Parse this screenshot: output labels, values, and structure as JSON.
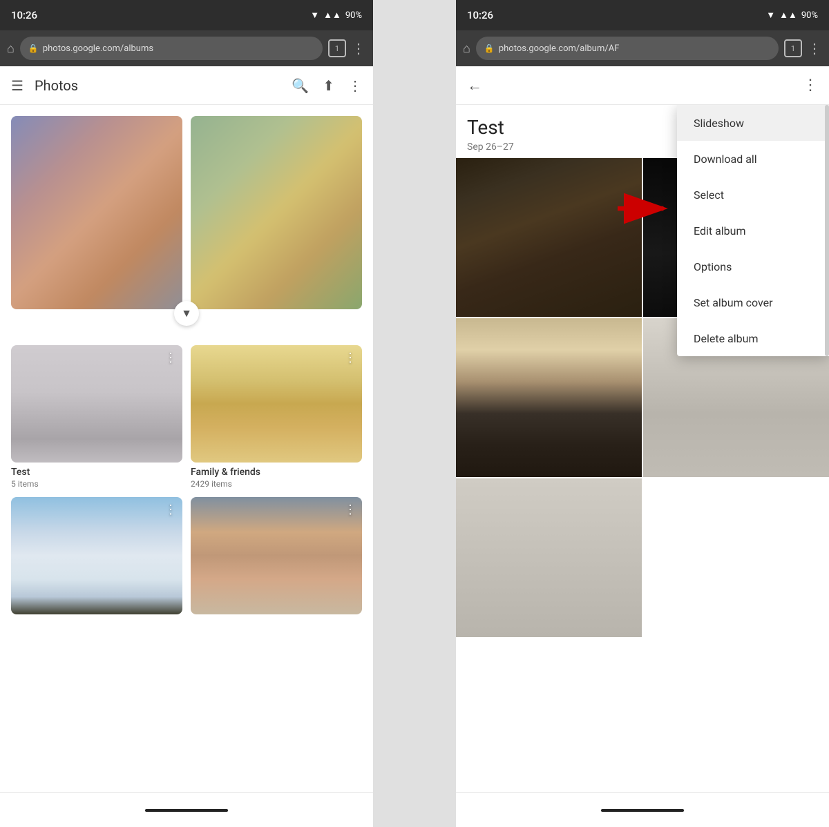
{
  "left_phone": {
    "status": {
      "time": "10:26",
      "battery": "90%",
      "wifi_icon": "▲",
      "signal_icon": "▲"
    },
    "address_bar": {
      "url": "photos.google.com/albums",
      "tab_count": "1"
    },
    "toolbar": {
      "title": "Photos",
      "menu_icon": "☰",
      "search_icon": "🔍",
      "upload_icon": "⬆",
      "more_icon": "⋮"
    },
    "albums": [
      {
        "id": "test",
        "name": "Test",
        "count": "5 items"
      },
      {
        "id": "family",
        "name": "Family & friends",
        "count": "2429 items"
      },
      {
        "id": "taj",
        "name": "",
        "count": ""
      },
      {
        "id": "selfie",
        "name": "",
        "count": ""
      }
    ]
  },
  "right_phone": {
    "status": {
      "time": "10:26",
      "battery": "90%"
    },
    "address_bar": {
      "url": "photos.google.com/album/AF",
      "tab_count": "1"
    },
    "toolbar": {
      "back_icon": "←",
      "more_icon": "⋮"
    },
    "album": {
      "title": "Test",
      "date": "Sep 26–27"
    },
    "context_menu": {
      "items": [
        "Slideshow",
        "Download all",
        "Select",
        "Edit album",
        "Options",
        "Set album cover",
        "Delete album"
      ]
    }
  }
}
